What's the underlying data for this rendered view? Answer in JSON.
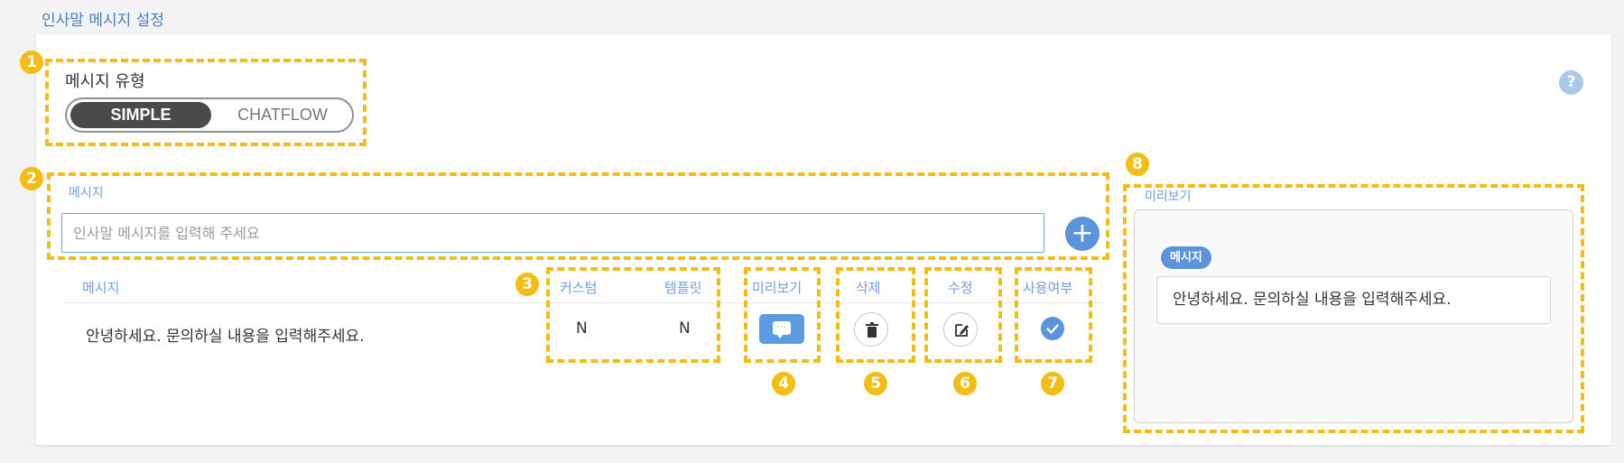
{
  "page": {
    "title": "인사말 메시지 설정"
  },
  "message_type": {
    "label": "메시지 유형",
    "options": [
      "SIMPLE",
      "CHATFLOW"
    ],
    "selected": "SIMPLE"
  },
  "message_input": {
    "label": "메시지",
    "placeholder": "인사말 메시지를 입력해 주세요",
    "value": "",
    "add_symbol": "+"
  },
  "table": {
    "headers": {
      "message": "메시지",
      "custom": "커스텀",
      "template": "템플릿",
      "preview": "미리보기",
      "delete": "삭제",
      "edit": "수정",
      "enabled": "사용여부"
    },
    "rows": [
      {
        "message": "안녕하세요. 문의하실 내용을 입력해주세요.",
        "custom": "N",
        "template": "N",
        "enabled": true
      }
    ]
  },
  "preview_panel": {
    "label": "미리보기",
    "badge": "메시지",
    "message": "안녕하세요. 문의하실 내용을 입력해주세요."
  },
  "help": {
    "symbol": "?"
  },
  "annotations": [
    "1",
    "2",
    "3",
    "4",
    "5",
    "6",
    "7",
    "8"
  ],
  "colors": {
    "accent": "#5b93dc",
    "highlight": "#f5bd14",
    "toggle_active": "#4a4a4a",
    "label_blue": "#6f9fd8"
  },
  "icons": {
    "preview": "chat-bubble-icon",
    "delete": "trash-icon",
    "edit": "edit-icon",
    "enabled": "check-icon",
    "help": "question-icon"
  }
}
